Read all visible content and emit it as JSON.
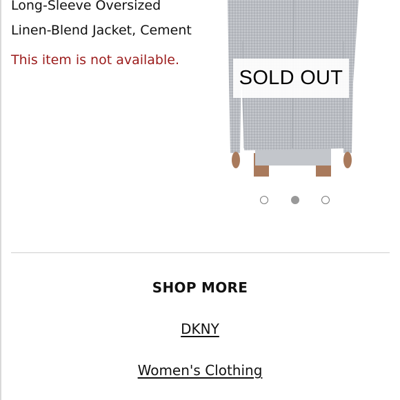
{
  "product": {
    "title_line1": "Long-Sleeve Oversized",
    "title_line2": "Linen-Blend Jacket, Cement",
    "availability": "This item is not available.",
    "sold_out_label": "SOLD OUT"
  },
  "carousel": {
    "dot_count": 3,
    "active_index": 1
  },
  "shop_more": {
    "heading": "SHOP MORE",
    "links": [
      "DKNY",
      "Women's Clothing"
    ]
  },
  "colors": {
    "availability_text": "#9b1b1b",
    "jacket": "#b9bcc2",
    "skin": "#a97a5c"
  }
}
